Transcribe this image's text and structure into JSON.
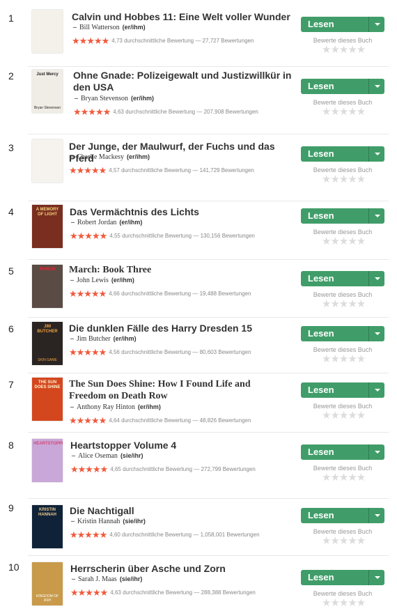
{
  "books": [
    {
      "rank": "1",
      "title": "Calvin und Hobbes 11: Eine Welt voller Wunder",
      "author": "Bill Watterson",
      "role": "(er/ihm)",
      "stars": "★★★★★",
      "rating_text": "4,73 durchschnittliche Bewertung — 27,727 Bewertungen",
      "read_label": "Lesen",
      "rate_label": "Bewerte dieses Buch",
      "rate_stars": "★★★★★",
      "cover_title": "",
      "cover_bottom": ""
    },
    {
      "rank": "2",
      "title": "Ohne Gnade: Polizeigewalt und Justizwillkür in den USA",
      "author": "Bryan Stevenson",
      "role": "(er/ihm)",
      "stars": "★★★★★",
      "rating_text": "4,63 durchschnittliche Bewertung — 207,908 Bewertungen",
      "read_label": "Lesen",
      "rate_label": "Bewerte dieses Buch",
      "rate_stars": "★★★★★",
      "cover_title": "Just Mercy",
      "cover_bottom": "Bryan Stevenson"
    },
    {
      "rank": "3",
      "title": "Der Junge, der Maulwurf, der Fuchs und das Pferd",
      "author": "Charlie Mackesy",
      "role": "(er/ihm)",
      "stars": "★★★★★",
      "rating_text": "4,57 durchschnittliche Bewertung — 141,729 Bewertungen",
      "read_label": "Lesen",
      "rate_label": "Bewerte dieses Buch",
      "rate_stars": "★★★★★",
      "cover_title": "",
      "cover_bottom": ""
    },
    {
      "rank": "4",
      "title": "Das Vermächtnis des Lichts",
      "author": "Robert Jordan",
      "role": "(er/ihm)",
      "stars": "★★★★★",
      "rating_text": "4,55 durchschnittliche Bewertung — 130,156 Bewertungen",
      "read_label": "Lesen",
      "rate_label": "Bewerte dieses Buch",
      "rate_stars": "★★★★★",
      "cover_title": "A MEMORY OF LIGHT",
      "cover_bottom": ""
    },
    {
      "rank": "5",
      "title": "March: Book Three",
      "author": "John Lewis",
      "role": "(er/ihm)",
      "stars": "★★★★★",
      "rating_text": "4,66 durchschnittliche Bewertung — 19,488 Bewertungen",
      "read_label": "Lesen",
      "rate_label": "Bewerte dieses Buch",
      "rate_stars": "★★★★★",
      "cover_title": "MARCH",
      "cover_bottom": ""
    },
    {
      "rank": "6",
      "title": "Die dunklen Fälle des Harry Dresden 15",
      "author": "Jim Butcher",
      "role": "(er/ihm)",
      "stars": "★★★★★",
      "rating_text": "4,56 durchschnittliche Bewertung — 80,603 Bewertungen",
      "read_label": "Lesen",
      "rate_label": "Bewerte dieses Buch",
      "rate_stars": "★★★★★",
      "cover_title": "JIM BUTCHER",
      "cover_bottom": "SKIN GAME"
    },
    {
      "rank": "7",
      "title": "The Sun Does Shine: How I Found Life and Freedom on Death Row",
      "author": "Anthony Ray Hinton",
      "role": "(er/ihm)",
      "stars": "★★★★★",
      "rating_text": "4,64 durchschnittliche Bewertung — 48,826 Bewertungen",
      "read_label": "Lesen",
      "rate_label": "Bewerte dieses Buch",
      "rate_stars": "★★★★★",
      "cover_title": "THE SUN DOES SHINE",
      "cover_bottom": ""
    },
    {
      "rank": "8",
      "title": "Heartstopper Volume 4",
      "author": "Alice Oseman",
      "role": "(sie/ihr)",
      "stars": "★★★★★",
      "rating_text": "4,65 durchschnittliche Bewertung — 272,799 Bewertungen",
      "read_label": "Lesen",
      "rate_label": "Bewerte dieses Buch",
      "rate_stars": "★★★★★",
      "cover_title": "HEARTSTOPPER",
      "cover_bottom": ""
    },
    {
      "rank": "9",
      "title": "Die Nachtigall",
      "author": "Kristin Hannah",
      "role": "(sie/ihr)",
      "stars": "★★★★★",
      "rating_text": "4,60 durchschnittliche Bewertung — 1,058,001 Bewertungen",
      "read_label": "Lesen",
      "rate_label": "Bewerte dieses Buch",
      "rate_stars": "★★★★★",
      "cover_title": "KRISTIN HANNAH",
      "cover_bottom": ""
    },
    {
      "rank": "10",
      "title": "Herrscherin über Asche und Zorn",
      "author": "Sarah J. Maas",
      "role": "(sie/ihr)",
      "stars": "★★★★★",
      "rating_text": "4,63 durchschnittliche Bewertung — 288,388 Bewertungen",
      "read_label": "Lesen",
      "rate_label": "Bewerte dieses Buch",
      "rate_stars": "★★★★★",
      "cover_title": "",
      "cover_bottom": "KINGDOM OF ASH"
    }
  ],
  "colors": {
    "accent": "#409d69",
    "star": "#f05a3c",
    "star_empty": "#dcdcdc"
  },
  "icons": {
    "dropdown": "chevron-down-icon",
    "rating": "star-icon"
  }
}
